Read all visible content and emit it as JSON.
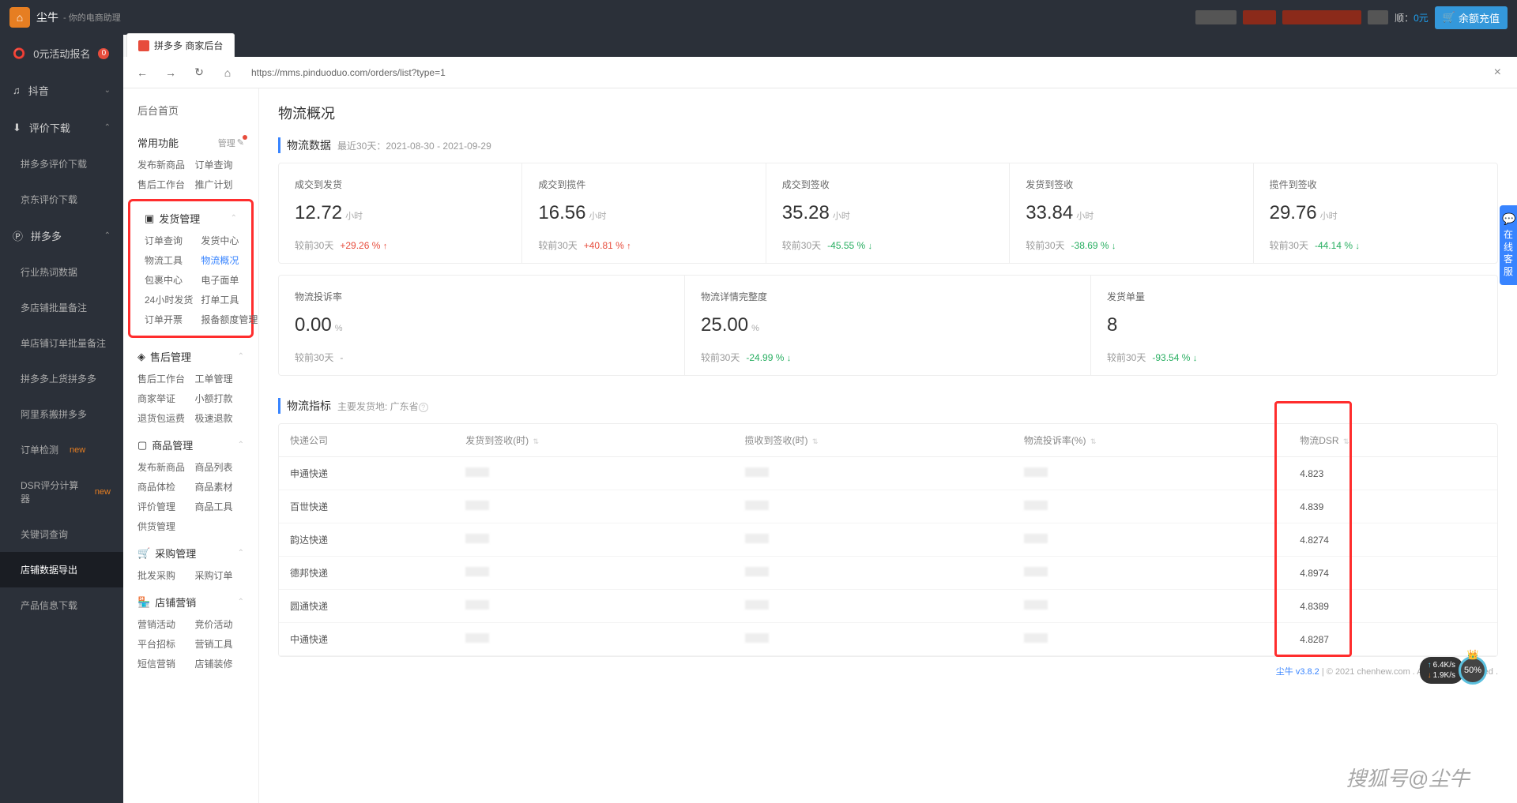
{
  "brand": "尘牛",
  "brand_sub": "- 你的电商助理",
  "account_prefix": "顺：",
  "balance": "0元",
  "recharge": "余额充值",
  "dark_sidebar": {
    "promo": "0元活动报名",
    "douyin": "抖音",
    "review_dl": "评价下载",
    "pdd_review": "拼多多评价下载",
    "jd_review": "京东评价下载",
    "pdd": "拼多多",
    "hotword": "行业热词数据",
    "batch_note": "多店铺批量备注",
    "single_note": "单店铺订单批量备注",
    "upload": "拼多多上货拼多多",
    "ali": "阿里系搬拼多多",
    "order_check": "订单检测",
    "dsr_calc": "DSR评分计算器",
    "keyword": "关键词查询",
    "export": "店铺数据导出",
    "product_dl": "产品信息下载"
  },
  "tab_title": "拼多多 商家后台",
  "url": "https://mms.pinduoduo.com/orders/list?type=1",
  "light_sidebar": {
    "home": "后台首页",
    "common": {
      "title": "常用功能",
      "manage": "管理",
      "i1": "发布新商品",
      "i2": "订单查询",
      "i3": "售后工作台",
      "i4": "推广计划"
    },
    "ship": {
      "title": "发货管理",
      "i1": "订单查询",
      "i2": "发货中心",
      "i3": "物流工具",
      "i4": "物流概况",
      "i5": "包裹中心",
      "i6": "电子面单",
      "i7": "24小时发货",
      "i8": "打单工具",
      "i9": "订单开票",
      "i10": "报备额度管理"
    },
    "after": {
      "title": "售后管理",
      "i1": "售后工作台",
      "i2": "工单管理",
      "i3": "商家举证",
      "i4": "小额打款",
      "i5": "退货包运费",
      "i6": "极速退款"
    },
    "goods": {
      "title": "商品管理",
      "i1": "发布新商品",
      "i2": "商品列表",
      "i3": "商品体检",
      "i4": "商品素材",
      "i5": "评价管理",
      "i6": "商品工具",
      "i7": "供货管理"
    },
    "purchase": {
      "title": "采购管理",
      "i1": "批发采购",
      "i2": "采购订单"
    },
    "shop": {
      "title": "店铺营销",
      "i1": "营销活动",
      "i2": "竞价活动",
      "i3": "平台招标",
      "i4": "营销工具",
      "i5": "短信营销",
      "i6": "店铺装修"
    }
  },
  "page_title": "物流概况",
  "section1_title": "物流数据",
  "date_range": "最近30天：2021-08-30 - 2021-09-29",
  "compare_label": "较前30天",
  "unit_hour": "小时",
  "unit_pct": "%",
  "stats_row1": [
    {
      "label": "成交到发货",
      "value": "12.72",
      "unit": "小时",
      "change": "+29.26 %",
      "dir": "up"
    },
    {
      "label": "成交到揽件",
      "value": "16.56",
      "unit": "小时",
      "change": "+40.81 %",
      "dir": "up"
    },
    {
      "label": "成交到签收",
      "value": "35.28",
      "unit": "小时",
      "change": "-45.55 %",
      "dir": "down"
    },
    {
      "label": "发货到签收",
      "value": "33.84",
      "unit": "小时",
      "change": "-38.69 %",
      "dir": "down"
    },
    {
      "label": "揽件到签收",
      "value": "29.76",
      "unit": "小时",
      "change": "-44.14 %",
      "dir": "down"
    }
  ],
  "stats_row2": [
    {
      "label": "物流投诉率",
      "value": "0.00",
      "unit": "%",
      "change": "-",
      "dir": "none"
    },
    {
      "label": "物流详情完整度",
      "value": "25.00",
      "unit": "%",
      "change": "-24.99 %",
      "dir": "down"
    },
    {
      "label": "发货单量",
      "value": "8",
      "unit": "",
      "change": "-93.54 %",
      "dir": "down"
    }
  ],
  "section2_title": "物流指标",
  "section2_sub": "主要发货地: 广东省",
  "table": {
    "headers": [
      "快递公司",
      "发货到签收(时)",
      "揽收到签收(时)",
      "物流投诉率(%)",
      "物流DSR"
    ],
    "rows": [
      {
        "company": "申通快递",
        "dsr": "4.823"
      },
      {
        "company": "百世快递",
        "dsr": "4.839"
      },
      {
        "company": "韵达快递",
        "dsr": "4.8274"
      },
      {
        "company": "德邦快递",
        "dsr": "4.8974"
      },
      {
        "company": "圆通快递",
        "dsr": "4.8389"
      },
      {
        "company": "中通快递",
        "dsr": "4.8287"
      }
    ]
  },
  "footer_ver": "尘牛 v3.8.2",
  "footer_copy": " | © 2021 chenhew.com . All Rights Reserved .",
  "support": "在线客服",
  "speed_up": "6.4K/s",
  "speed_dn": "1.9K/s",
  "speed_pct": "50%",
  "watermark": "搜狐号@尘牛"
}
